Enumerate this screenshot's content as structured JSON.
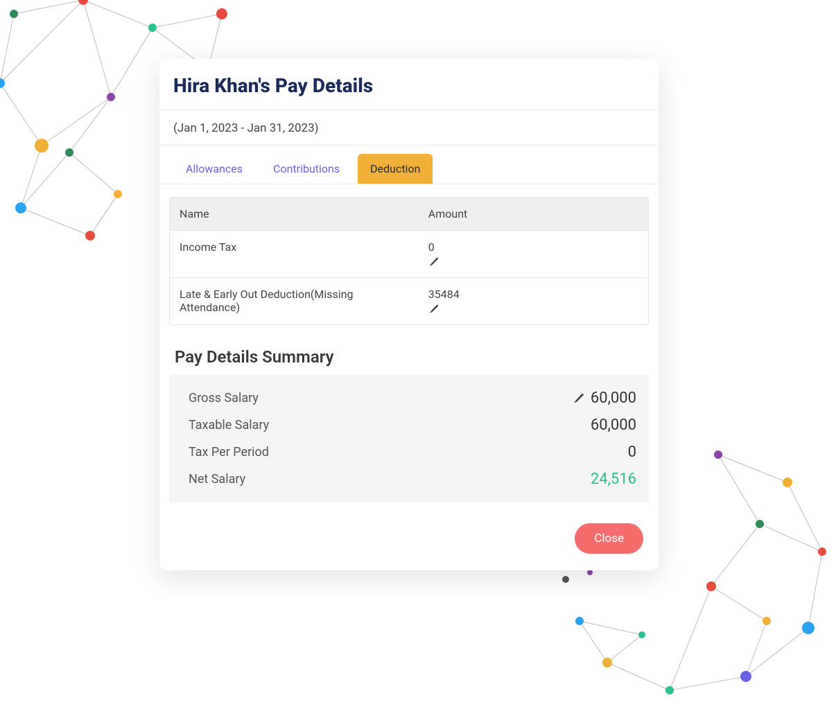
{
  "modal": {
    "title": "Hira Khan's Pay Details",
    "period": "(Jan 1, 2023 - Jan 31, 2023)",
    "tabs": {
      "allowances": "Allowances",
      "contributions": "Contributions",
      "deduction": "Deduction",
      "active": "deduction"
    },
    "table": {
      "headers": {
        "name": "Name",
        "amount": "Amount"
      },
      "rows": [
        {
          "name": "Income Tax",
          "amount": "0"
        },
        {
          "name": "Late & Early Out Deduction(Missing Attendance)",
          "amount": "35484"
        }
      ]
    },
    "summary": {
      "title": "Pay Details Summary",
      "rows": {
        "gross": {
          "label": "Gross Salary",
          "value": "60,000",
          "editable": true
        },
        "taxable": {
          "label": "Taxable Salary",
          "value": "60,000"
        },
        "taxper": {
          "label": "Tax Per Period",
          "value": "0"
        },
        "net": {
          "label": "Net Salary",
          "value": "24,516"
        }
      }
    },
    "footer": {
      "close": "Close"
    }
  }
}
